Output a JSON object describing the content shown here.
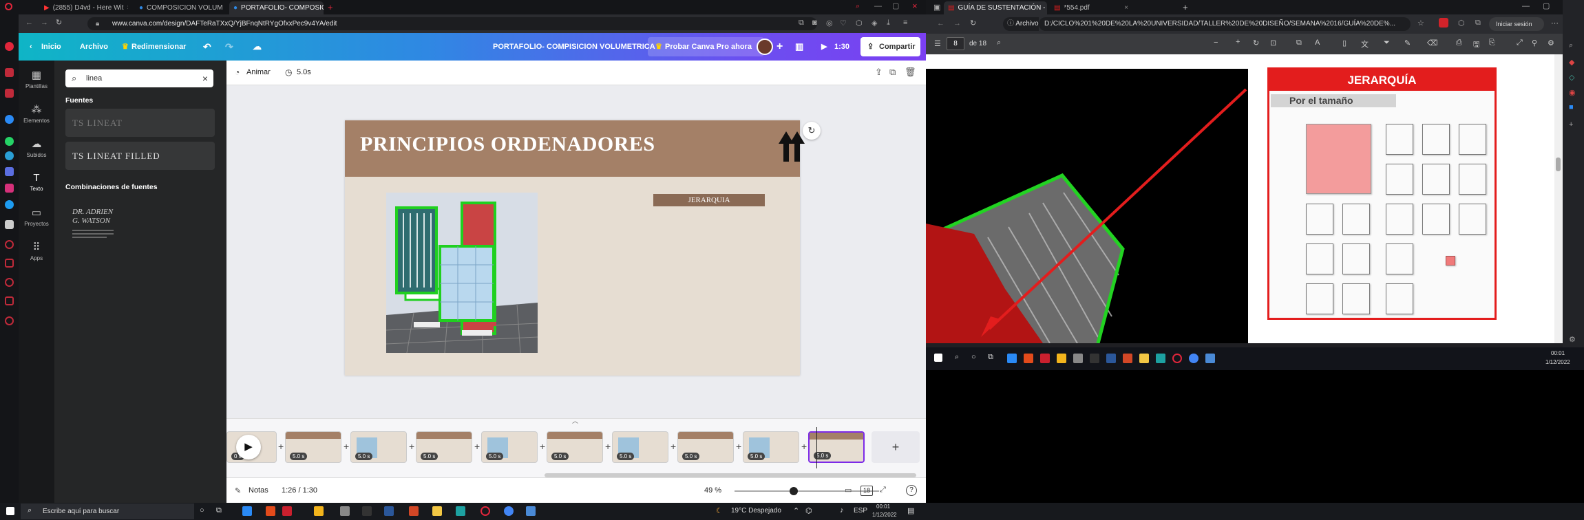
{
  "left_browser": {
    "tabs": [
      {
        "label": "(2855) D4vd - Here Wit",
        "active": false
      },
      {
        "label": "COMPOSICION VOLUMETR",
        "active": false
      },
      {
        "label": "PORTAFOLIO- COMPOSICI",
        "active": true
      }
    ],
    "url": "www.canva.com/design/DAFTeRaTXxQ/YjBFnqNtRYgOfxxPec9v4YA/edit"
  },
  "canva": {
    "header": {
      "home": "Inicio",
      "file": "Archivo",
      "resize": "Redimensionar",
      "doc_title": "PORTAFOLIO- COMPISICION VOLUMETRICA",
      "pro": "Probar Canva Pro ahora",
      "duration": "1:30",
      "share": "Compartir"
    },
    "rail": [
      {
        "label": "Plantillas",
        "icon": "template-icon"
      },
      {
        "label": "Elementos",
        "icon": "elements-icon"
      },
      {
        "label": "Subidos",
        "icon": "upload-icon"
      },
      {
        "label": "Texto",
        "icon": "text-icon"
      },
      {
        "label": "Proyectos",
        "icon": "folder-icon"
      },
      {
        "label": "Apps",
        "icon": "apps-icon"
      }
    ],
    "panel": {
      "search_value": "linea",
      "fonts_heading": "Fuentes",
      "font1": "TS LINEAT",
      "font2": "TS LINEAT FILLED",
      "combos_heading": "Combinaciones de fuentes",
      "combo_name": "DR. ADRIEN G. WATSON"
    },
    "editor": {
      "animate": "Animar",
      "time": "5.0s"
    },
    "slide": {
      "title": "PRINCIPIOS ORDENADORES",
      "label": "JERARQUIA"
    },
    "timeline": {
      "badges": [
        "0 s",
        "5.0 s",
        "5.0 s",
        "5.0 s",
        "5.0 s",
        "5.0 s",
        "5.0 s",
        "5.0 s",
        "5.0 s",
        "5.0 s"
      ]
    },
    "bottom": {
      "notes": "Notas",
      "time": "1:26 / 1:30",
      "zoom": "49 %",
      "pages": "18"
    }
  },
  "right_browser": {
    "tabs": [
      {
        "label": "GUÍA DE SUSTENTACIÓN - CO",
        "active": true
      },
      {
        "label": "*554.pdf",
        "active": false
      }
    ],
    "url_prefix": "Archivo",
    "url": "D:/CICLO%201%20DE%20LA%20UNIVERSIDAD/TALLER%20DE%20DISEÑO/SEMANA%2016/GUÍA%20DE%...",
    "signin": "Iniciar sesión",
    "page": "8",
    "of": "de 18",
    "pdf": {
      "heading": "JERARQUÍA",
      "subheading": "Por el tamaño"
    }
  },
  "taskbar": {
    "search": "Escribe aquí para buscar",
    "weather": "19°C  Despejado",
    "lang": "ESP",
    "time": "00:01",
    "date": "1/12/2022"
  },
  "right_taskbar": {
    "time": "00:01",
    "date": "1/12/2022"
  }
}
